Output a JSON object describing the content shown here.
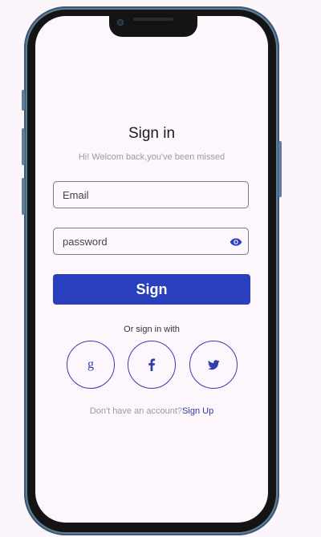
{
  "signin": {
    "title": "Sign in",
    "subtitle": "Hi! Welcom back,you've been missed",
    "email_placeholder": "Email",
    "password_placeholder": "password",
    "sign_button": "Sign",
    "or_text": "Or sign in with",
    "footer_text": "Don't have an account?",
    "footer_link": "Sign Up"
  },
  "social": {
    "google_glyph": "g"
  },
  "icons": {
    "password_toggle": "eye-icon",
    "google": "google-icon",
    "facebook": "facebook-icon",
    "twitter": "twitter-icon"
  },
  "colors": {
    "accent": "#2a3fbd",
    "background": "#fdf7fd",
    "phone_frame": "#5e7e99"
  }
}
